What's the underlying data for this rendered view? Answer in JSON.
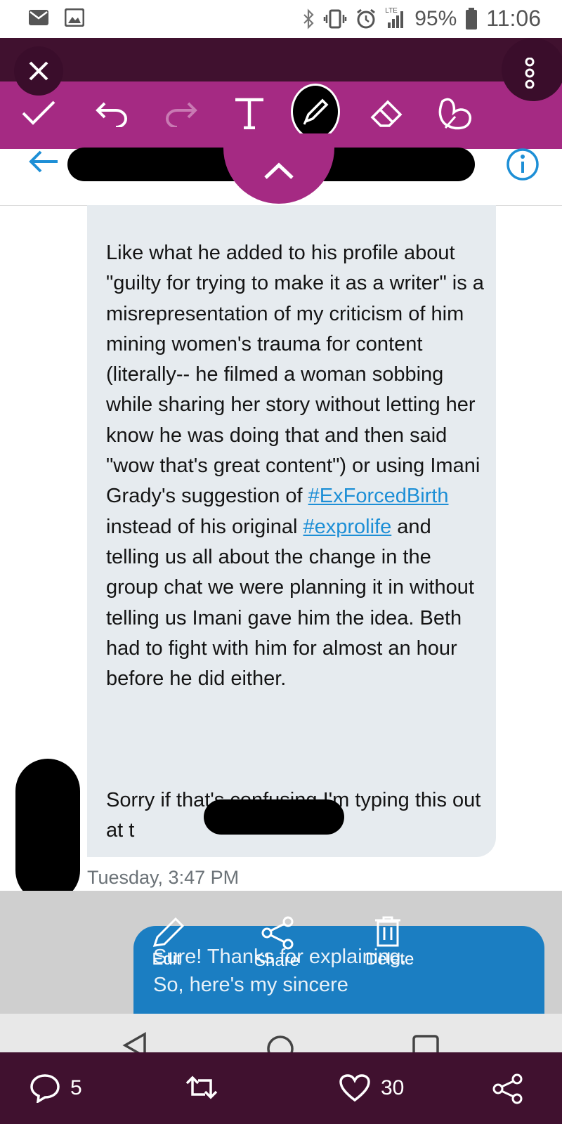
{
  "status_bar": {
    "lte": "LTE",
    "battery": "95%",
    "time": "11:06",
    "icons": [
      "mail-icon",
      "gallery-icon",
      "bluetooth-icon",
      "vibrate-icon",
      "alarm-icon",
      "signal-icon",
      "battery-icon"
    ]
  },
  "toolbar": {
    "tools": [
      "close-icon",
      "check-icon",
      "undo-icon",
      "redo-icon",
      "text-tool-icon",
      "pen-tool-icon",
      "eraser-icon",
      "sticker-icon",
      "more-vertical-icon"
    ],
    "active_tool": "pen",
    "accent": "#a52a83",
    "dark": "#40112f"
  },
  "message": {
    "p1_before": "Like what he added to his profile about \"guilty for trying to make it as a writer\" is a misrepresentation of my criticism of him mining women's trauma for content (literally-- he filmed a woman sobbing while sharing her story without letting her know he was doing that and then said \"wow that's great content\") or using Imani Grady's suggestion of ",
    "tag1": "#ExForcedBirth",
    "p1_middle": " instead of his original ",
    "tag2": "#exprolife",
    "p1_after": " and telling us all about the change in the group chat we were planning it in without telling us Imani gave him the idea. Beth had to fight with him for almost an hour before he did either.",
    "p2": "Sorry if that's confusing I'm typing this out at t",
    "timestamp": "Tuesday, 3:47 PM",
    "bubble_color": "#e6ebef",
    "link_color": "#1d8fd6"
  },
  "reply": {
    "line1": "Sure! Thanks for explaining.",
    "line2": "So, here's my sincere",
    "color": "#1b7ec2"
  },
  "actions": {
    "edit": "Edit",
    "share": "Share",
    "delete": "Delete"
  },
  "bottom_bar": {
    "replies": "5",
    "likes": "30"
  }
}
